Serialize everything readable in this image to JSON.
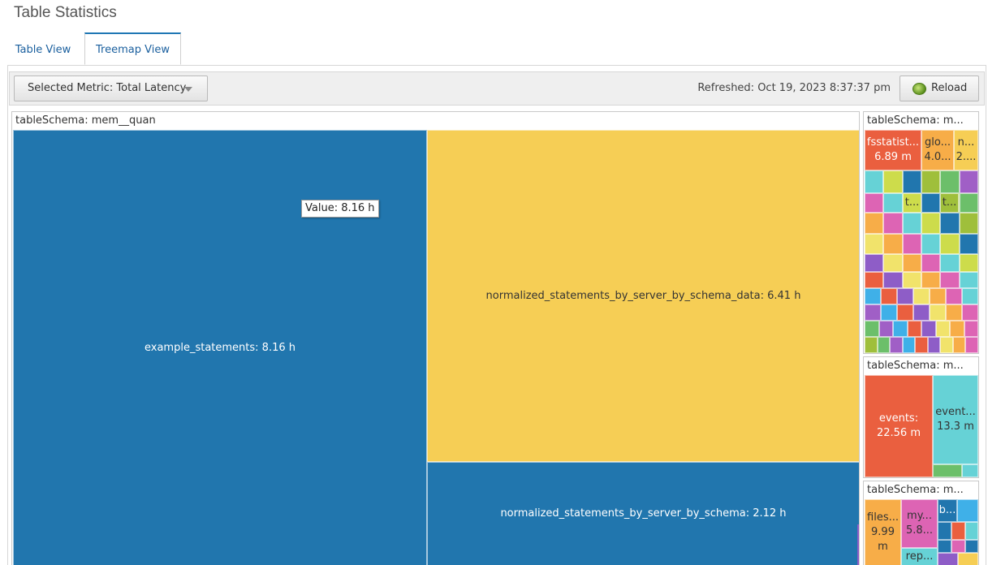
{
  "page": {
    "title": "Table Statistics"
  },
  "tabs": [
    {
      "label": "Table View",
      "active": false
    },
    {
      "label": "Treemap View",
      "active": true
    }
  ],
  "toolbar": {
    "metric_label": "Selected Metric: Total Latency",
    "refreshed": "Refreshed: Oct 19, 2023 8:37:37 pm",
    "reload_label": "Reload"
  },
  "treemap": {
    "tooltip": "Value: 8.16 h",
    "groups": [
      {
        "title": "tableSchema: mem__quan"
      },
      {
        "title": "tableSchema: m..."
      },
      {
        "title": "tableSchema: m..."
      },
      {
        "title": "tableSchema: m..."
      }
    ],
    "cells": [
      {
        "label": "example_statements: 8.16 h",
        "color": "#2176ae"
      },
      {
        "label": "normalized_statements_by_server_by_schema_data: 6.41 h",
        "color": "#f6ce55"
      },
      {
        "label": "normalized_statements_by_server_by_schema: 2.12 h",
        "color": "#2176ae"
      },
      {
        "label": "fsstatist... 6.89 m",
        "color": "#ea5f3f"
      },
      {
        "label": "glo... 4.0...",
        "color": "#f7ad48"
      },
      {
        "label": "n... 2....",
        "color": "#f6ce55"
      },
      {
        "label": "t...",
        "color": "#cddc4b"
      },
      {
        "label": "t...",
        "color": "#9fbf3b"
      },
      {
        "label": "events: 22.56 m",
        "color": "#ea5f3f"
      },
      {
        "label": "event... 13.3 m",
        "color": "#66d2d6"
      },
      {
        "label": "files... 9.99 m",
        "color": "#f7ad48"
      },
      {
        "label": "my... 5.8...",
        "color": "#dd64b4"
      },
      {
        "label": "b...",
        "color": "#2176ae"
      },
      {
        "label": "rep...",
        "color": "#66d2d6"
      }
    ]
  }
}
